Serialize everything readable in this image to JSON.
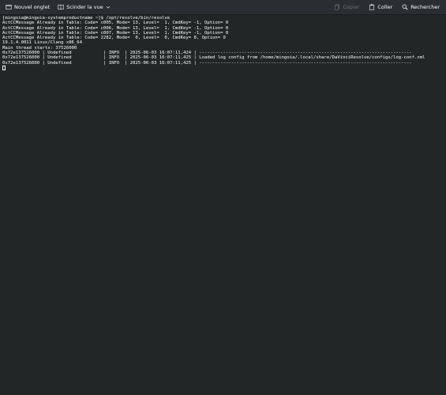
{
  "toolbar": {
    "new_tab_label": "Nouvel onglet",
    "split_view_label": "Scinder la vue",
    "copy_label": "Copier",
    "paste_label": "Coller",
    "search_label": "Rechercher"
  },
  "terminal": {
    "lines": [
      "[mingoia@mingoia-systemproductname ~]$ /opt/resolve/bin/resolve",
      "ActCCMessage Already in Table: Code= c005, Mode= 13, Level=  1, CmdKey= -1, Option= 0",
      "ActCCMessage Already in Table: Code= c006, Mode= 13, Level=  1, CmdKey= -1, Option= 0",
      "ActCCMessage Already in Table: Code= c007, Mode= 13, Level=  1, CmdKey= -1, Option= 0",
      "ActCCMessage Already in Table: Code= 2282, Mode=  0, Level=  0, CmdKey= 8, Option= 0",
      "19.1.4.0011 Linux/Clang x86_64",
      "Main thread starts: 37526000",
      "0x72e137526000 | Undefined            | INFO  | 2025-06-03 16:07:11,424 | --------------------------------------------------------------------------------",
      "0x72e137526000 | Undefined            | INFO  | 2025-06-03 16:07:11,425 | Loaded log config from /home/mingoia/.local/share/DaVinciResolve/configs/log-conf.xml",
      "0x72e137526000 | Undefined            | INFO  | 2025-06-03 16:07:11,425 | --------------------------------------------------------------------------------"
    ]
  },
  "colors": {
    "background": "#232627",
    "toolbar": "#2a2e32",
    "text": "#fcfcfc",
    "disabled_text": "#6e7175"
  },
  "icons": [
    "new-tab-icon",
    "split-view-icon",
    "chevron-down-icon",
    "copy-icon",
    "paste-icon",
    "search-icon"
  ]
}
